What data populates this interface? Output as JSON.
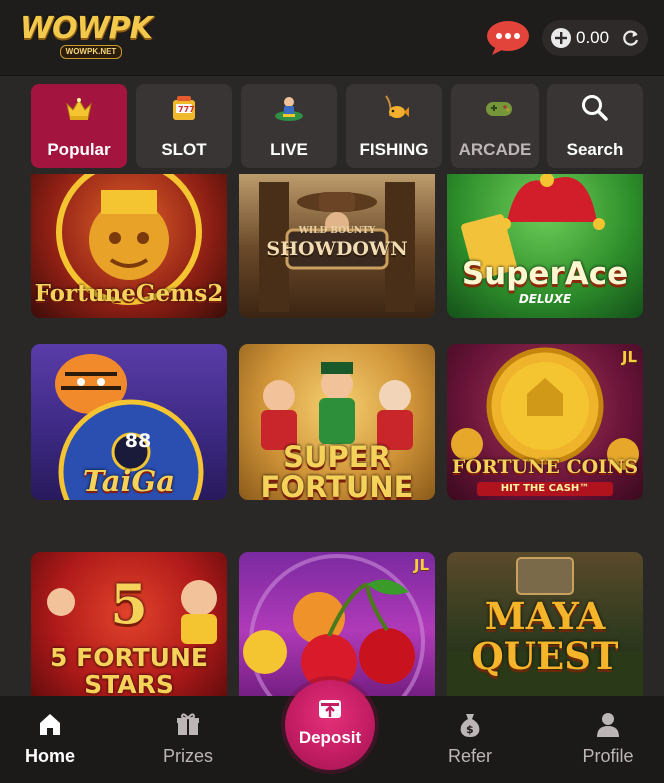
{
  "header": {
    "logo_text": "WOWPK",
    "logo_subtext": "WOWPK.NET",
    "balance": "0.00"
  },
  "tabs": [
    {
      "label": "Popular",
      "icon": "crown-icon",
      "active": true
    },
    {
      "label": "SLOT",
      "icon": "slot-machine-icon",
      "active": false
    },
    {
      "label": "LIVE",
      "icon": "live-dealer-icon",
      "active": false
    },
    {
      "label": "FISHING",
      "icon": "fish-icon",
      "active": false
    },
    {
      "label": "ARCADE",
      "icon": "gamepad-icon",
      "active": false
    },
    {
      "label": "Search",
      "icon": "search-icon",
      "active": false
    }
  ],
  "games": [
    {
      "title": "FortuneGems2",
      "provider_badge": ""
    },
    {
      "title": "SHOWDOWN",
      "subtitle": "WILD BOUNTY",
      "provider_badge": ""
    },
    {
      "title": "SuperAce",
      "subtitle": "DELUXE",
      "provider_badge": ""
    },
    {
      "title": "TaiGa",
      "extra": "88",
      "provider_badge": ""
    },
    {
      "title": "SUPER FORTUNE",
      "provider_badge": ""
    },
    {
      "title": "FORTUNE COINS",
      "subtitle": "HIT THE CASH™",
      "provider_badge": "JL"
    },
    {
      "title": "5 FORTUNE STARS",
      "provider_badge": ""
    },
    {
      "title": "",
      "provider_badge": "JL"
    },
    {
      "title": "MAYA QUEST",
      "provider_badge": ""
    }
  ],
  "bottom_nav": {
    "home": "Home",
    "prizes": "Prizes",
    "deposit": "Deposit",
    "refer": "Refer",
    "profile": "Profile"
  },
  "colors": {
    "accent": "#a3153f",
    "deposit": "#d0246c",
    "background": "#2a2727"
  }
}
